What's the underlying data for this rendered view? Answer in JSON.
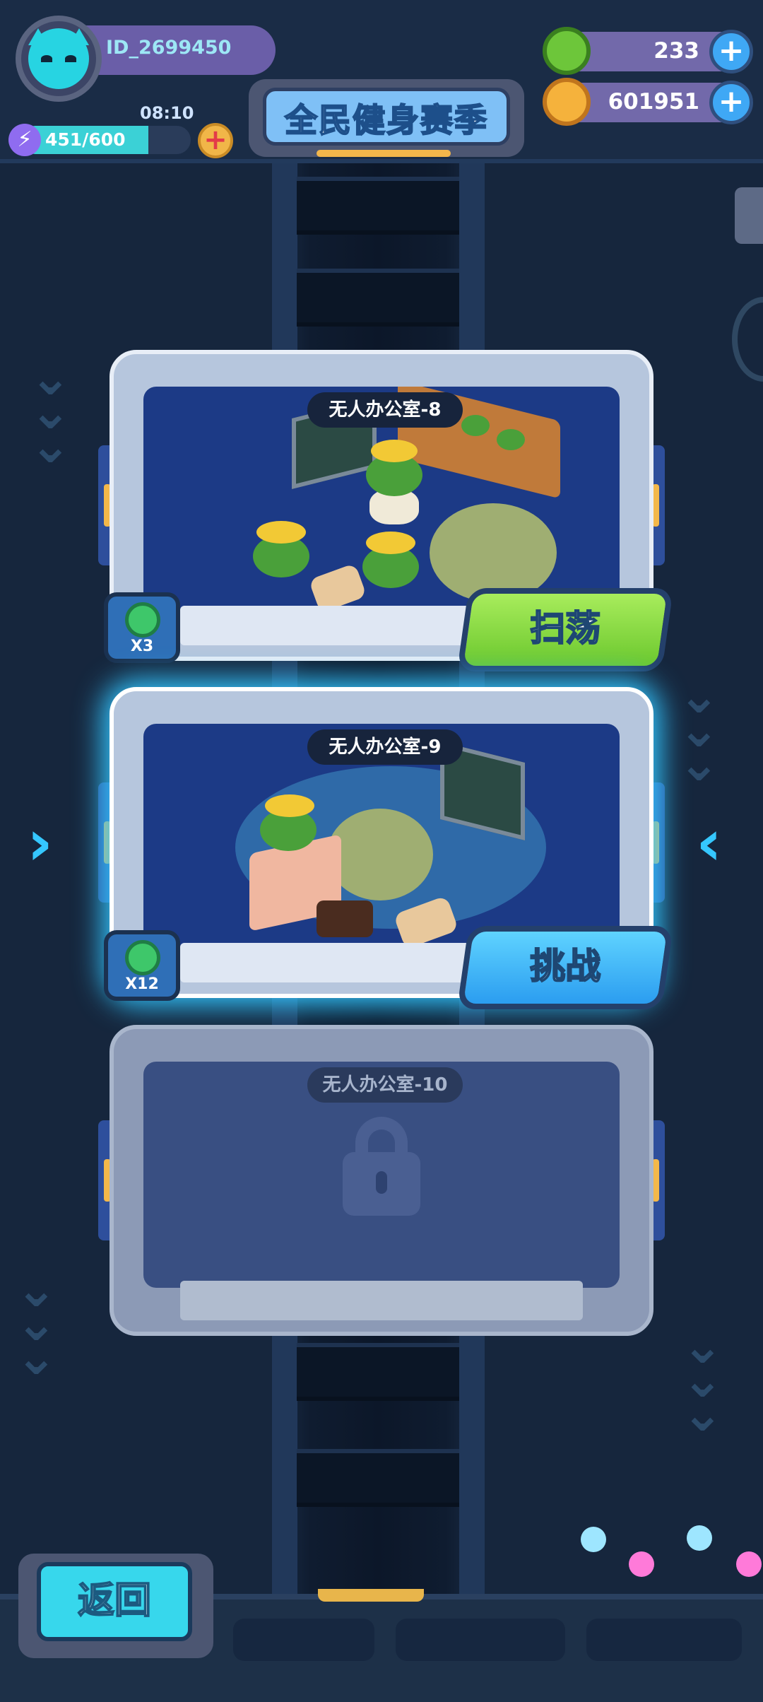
{
  "player": {
    "id": "ID_2699450",
    "energy_timer": "08:10",
    "energy": "451/600",
    "energy_fraction": 0.75
  },
  "resources": [
    {
      "name": "gem",
      "icon": "green-gem-icon",
      "value": "233"
    },
    {
      "name": "coin",
      "icon": "gold-planet-coin-icon",
      "value": "601951"
    }
  ],
  "season_title": "全民健身赛季",
  "levels": [
    {
      "name": "无人办公室-8",
      "reward": "X3",
      "action": "扫荡",
      "state": "cleared"
    },
    {
      "name": "无人办公室-9",
      "reward": "X12",
      "action": "挑战",
      "state": "current"
    },
    {
      "name": "无人办公室-10",
      "state": "locked"
    }
  ],
  "back_label": "返回",
  "colors": {
    "accent": "#35c7ff",
    "sweep": "#7fd63f",
    "challenge": "#2b9df0",
    "background": "#16263d"
  }
}
